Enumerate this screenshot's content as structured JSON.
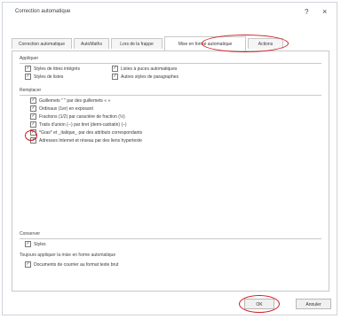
{
  "window": {
    "title": "Correction automatique",
    "help_glyph": "?",
    "close_glyph": "×"
  },
  "tabs": [
    {
      "label": "Correction automatique"
    },
    {
      "label": "AutoMaths"
    },
    {
      "label": "Lors de la frappe"
    },
    {
      "label": "Mise en forme automatique"
    },
    {
      "label": "Actions"
    }
  ],
  "sections": {
    "appliquer": {
      "label": "Appliquer",
      "items": [
        {
          "label": "Styles de titres intégrés",
          "checked": true
        },
        {
          "label": "Listes à puces automatiques",
          "checked": true
        },
        {
          "label": "Styles de listes",
          "checked": true
        },
        {
          "label": "Autres styles de paragraphes",
          "checked": true
        }
      ]
    },
    "remplacer": {
      "label": "Remplacer",
      "items": [
        {
          "label": "Guillemets \" \" par des guillemets « »",
          "checked": true
        },
        {
          "label": "Ordinaux (1er) en exposant",
          "checked": true
        },
        {
          "label": "Fractions (1/2) par caractère de fraction (½)",
          "checked": true
        },
        {
          "label": "Traits d'union (--) par tiret (demi-cadratin) (–)",
          "checked": true
        },
        {
          "label": "*Gras* et _italique_ par des attributs correspondants",
          "checked": true
        },
        {
          "label": "Adresses Internet et réseau par des liens hypertexte",
          "checked": true
        }
      ]
    },
    "conserver": {
      "label": "Conserver",
      "items": [
        {
          "label": "Styles",
          "checked": true
        }
      ]
    },
    "toujours": {
      "label": "Toujours appliquer la mise en forme automatique",
      "items": [
        {
          "label": "Documents de courrier au format texte brut",
          "checked": true
        }
      ]
    }
  },
  "buttons": {
    "ok": "OK",
    "cancel": "Annuler"
  },
  "colors": {
    "highlight": "#d11a1a"
  }
}
